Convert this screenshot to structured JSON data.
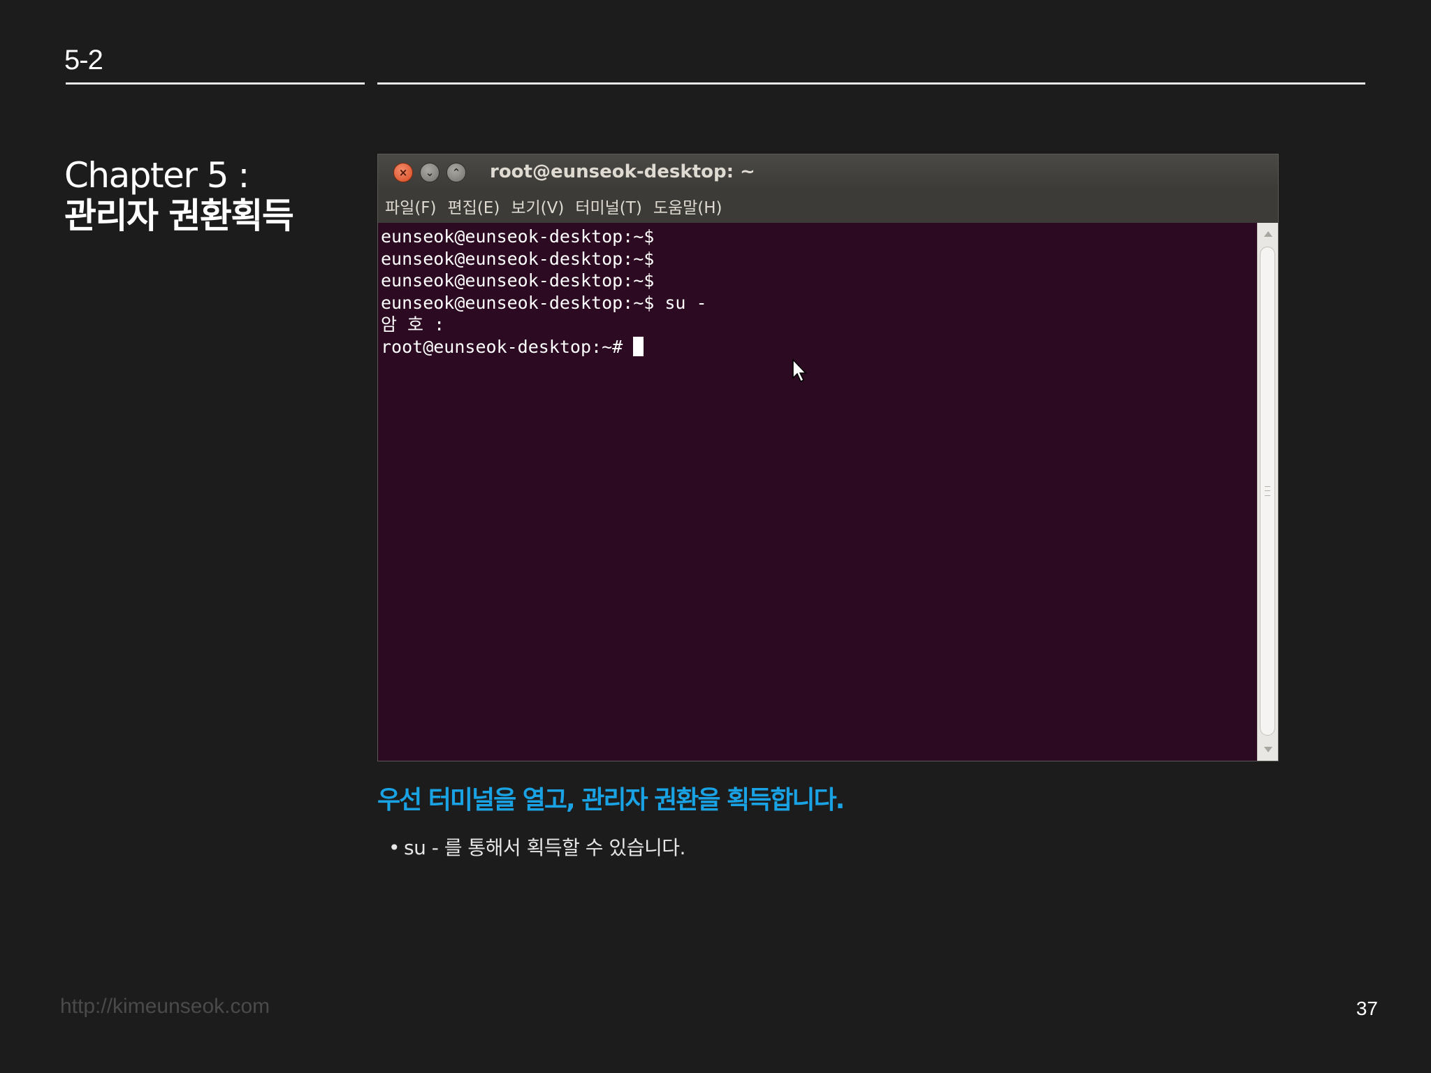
{
  "slide": {
    "section_number": "5-2",
    "chapter_title_line1": "Chapter 5 :",
    "chapter_title_line2": "관리자 권환획득",
    "caption_heading": "우선 터미널을 열고, 관리자 권환을 획득합니다.",
    "bullet_symbol": "•",
    "bullet_text": "su - 를 통해서 획득할 수 있습니다.",
    "footer_url": "http://kimeunseok.com",
    "page_number": "37"
  },
  "terminal": {
    "window_title": "root@eunseok-desktop: ~",
    "close_glyph": "×",
    "minimize_glyph": "⌄",
    "maximize_glyph": "⌃",
    "menu": [
      {
        "label": "파일(F)"
      },
      {
        "label": "편집(E)"
      },
      {
        "label": "보기(V)"
      },
      {
        "label": "터미널(T)"
      },
      {
        "label": "도움말(H)"
      }
    ],
    "lines": [
      {
        "text": "eunseok@eunseok-desktop:~$"
      },
      {
        "text": "eunseok@eunseok-desktop:~$"
      },
      {
        "text": "eunseok@eunseok-desktop:~$"
      },
      {
        "text": "eunseok@eunseok-desktop:~$ su -"
      },
      {
        "text": "암 호 :"
      }
    ],
    "prompt_line": "root@eunseok-desktop:~# "
  },
  "colors": {
    "background": "#1c1c1c",
    "terminal_bg": "#2c0a21",
    "accent_blue": "#1aa3e4",
    "titlebar": "#3c3b37",
    "close_button": "#d74a22"
  },
  "icons": {
    "close": "close-icon",
    "minimize": "minimize-icon",
    "maximize": "maximize-icon",
    "pointer": "mouse-pointer-icon",
    "scroll_up": "scroll-up-arrow-icon",
    "scroll_down": "scroll-down-arrow-icon"
  }
}
